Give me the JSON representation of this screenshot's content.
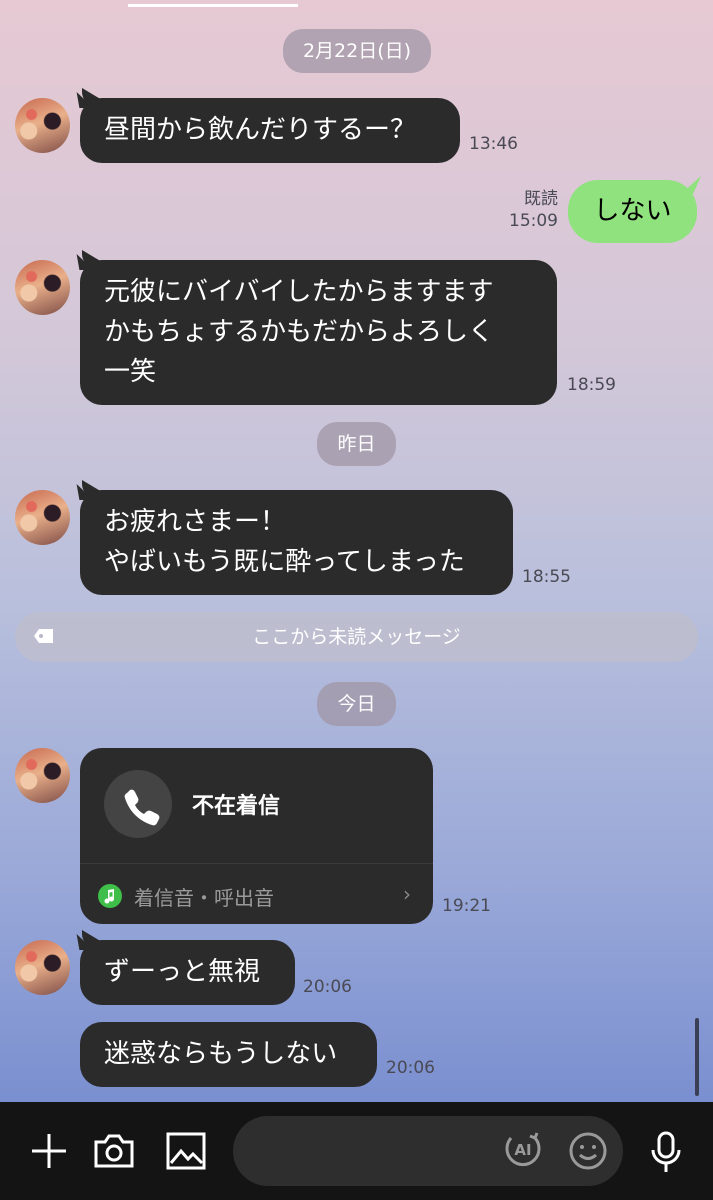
{
  "dates": {
    "feb22": "2月22日(日)",
    "yesterday": "昨日",
    "today": "今日"
  },
  "messages": [
    {
      "text": "昼間から飲んだりするー？",
      "time": "13:46"
    },
    {
      "text": "元彼にバイバイしたからますます\nかもちょするかもだからよろしく\n一笑",
      "time": "18:59"
    },
    {
      "text": "お疲れさまー！\nやばいもう既に酔ってしまった",
      "time": "18:55"
    },
    {
      "text": "ずーっと無視",
      "time": "20:06"
    },
    {
      "text": "迷惑ならもうしない",
      "time": "20:06"
    }
  ],
  "outgoing": {
    "text": "しない",
    "read_label": "既読",
    "time": "15:09"
  },
  "unread_divider": "ここから未読メッセージ",
  "call": {
    "title": "不在着信",
    "ringtone_label": "着信音・呼出音",
    "time": "19:21"
  },
  "composer": {
    "ai_label": "AI"
  },
  "colors": {
    "incoming_bubble": "#2b2b2b",
    "outgoing_bubble": "#8fe27e",
    "bottom_bar": "#141414"
  }
}
